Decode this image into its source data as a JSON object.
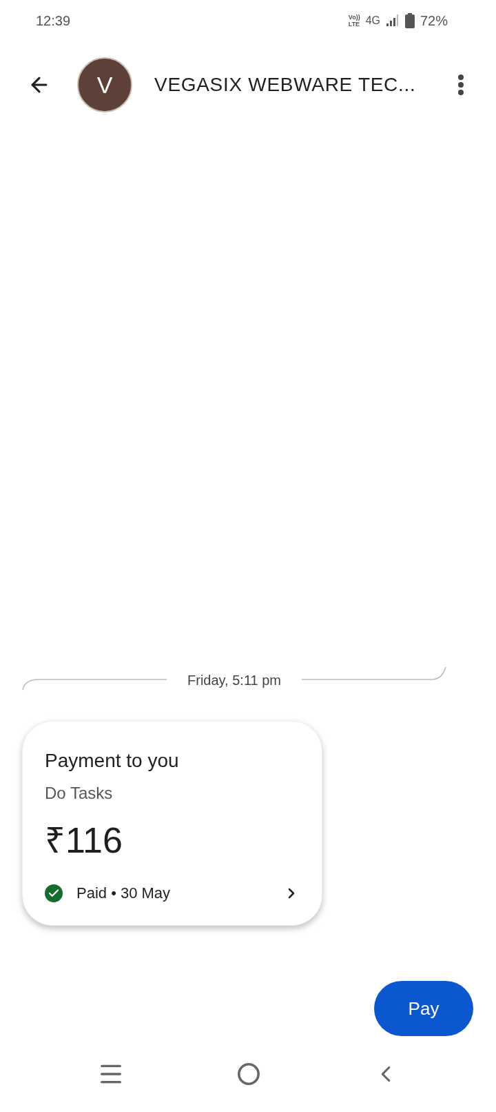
{
  "status_bar": {
    "time": "12:39",
    "network_top": "Vo))",
    "network_bottom": "LTE",
    "network": "4G",
    "battery": "72%"
  },
  "header": {
    "avatar_letter": "V",
    "title": "VEGASIX WEBWARE TEC..."
  },
  "timestamp": "Friday, 5:11 pm",
  "payment_card": {
    "title": "Payment to you",
    "note": "Do Tasks",
    "amount": "₹116",
    "paid": true,
    "status": "Paid • 30 May"
  },
  "pay_button": "Pay"
}
